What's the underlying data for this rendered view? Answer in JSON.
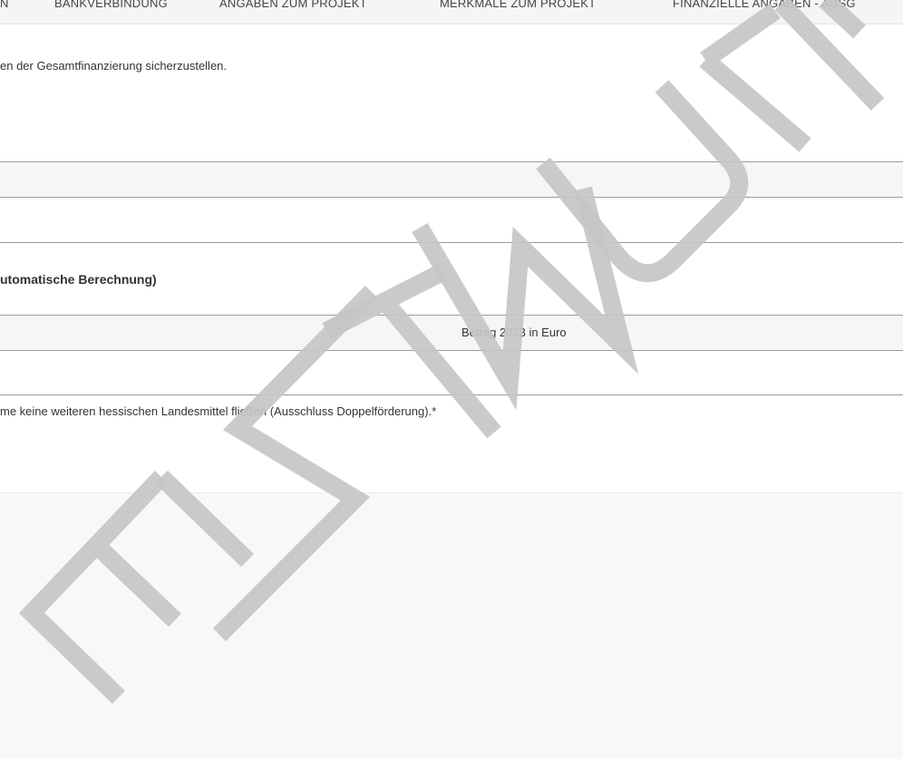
{
  "tabs": [
    {
      "label": "N"
    },
    {
      "label": "BANKVERBINDUNG"
    },
    {
      "label": "ANGABEN ZUM PROJEKT"
    },
    {
      "label": "MERKMALE ZUM PROJEKT"
    },
    {
      "label": "FINANZIELLE ANGABEN - AUSG"
    }
  ],
  "content": {
    "intro_text": "en der Gesamtfinanzierung sicherzustellen.",
    "section_heading": "utomatische Berechnung)",
    "table_header_amount": "Betrag 2023 in Euro",
    "declaration_text": "me keine weiteren hessischen Landesmittel fließen (Ausschluss Doppelförderung).*"
  },
  "watermark": {
    "text": "ENTWURF"
  }
}
